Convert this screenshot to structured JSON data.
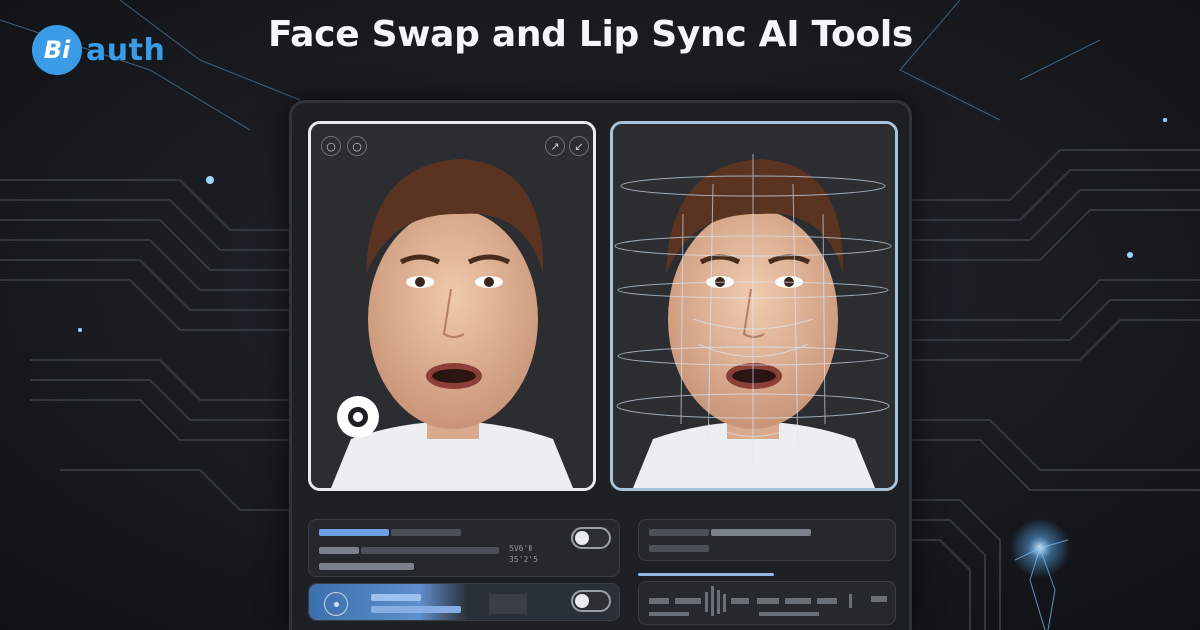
{
  "brand": {
    "badge": "Bi",
    "name": "auth",
    "accent": "#3a9ce6"
  },
  "headline": "Face Swap and Lip Sync AI Tools",
  "app": {
    "source_panel": {
      "top_left_icons": [
        "circle-icon",
        "circle-icon"
      ],
      "top_right_icons": [
        "expand-arrow-icon",
        "collapse-arrow-icon"
      ],
      "record_icon": "record-icon"
    },
    "target_panel": {
      "overlay": "face-mesh-icon"
    },
    "settings": {
      "card1_readout_line1": "5V6'Ⅱ",
      "card1_readout_line2": "35'2'5",
      "toggle1_on": false,
      "toggle2_on": false
    },
    "colors": {
      "background": "#15181d",
      "panel": "#1c1f24",
      "highlight": "#6c9fe3",
      "glow": "#7fc7ff"
    }
  }
}
